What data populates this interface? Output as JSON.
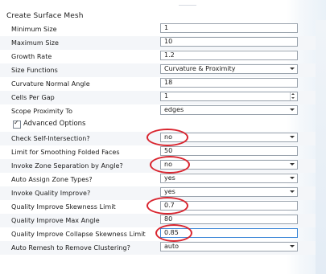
{
  "panel_title": "Create Surface Mesh",
  "basic_rows": [
    {
      "label": "Minimum Size",
      "value": "1",
      "control": "text"
    },
    {
      "label": "Maximum Size",
      "value": "10",
      "control": "text"
    },
    {
      "label": "Growth Rate",
      "value": "1.2",
      "control": "text"
    },
    {
      "label": "Size Functions",
      "value": "Curvature & Proximity",
      "control": "select"
    },
    {
      "label": "Curvature Normal Angle",
      "value": "18",
      "control": "text"
    },
    {
      "label": "Cells Per Gap",
      "value": "1",
      "control": "spin"
    },
    {
      "label": "Scope Proximity To",
      "value": "edges",
      "control": "select"
    }
  ],
  "advanced_options": {
    "label": "Advanced Options",
    "checked": true
  },
  "advanced_rows": [
    {
      "label": "Check Self-Intersection?",
      "value": "no",
      "control": "select"
    },
    {
      "label": "Limit for Smoothing Folded Faces",
      "value": "50",
      "control": "text"
    },
    {
      "label": "Invoke Zone Separation by Angle?",
      "value": "no",
      "control": "select"
    },
    {
      "label": "Auto Assign Zone Types?",
      "value": "yes",
      "control": "select"
    },
    {
      "label": "Invoke Quality Improve?",
      "value": "yes",
      "control": "select"
    },
    {
      "label": "Quality Improve Skewness Limit",
      "value": "0.7",
      "control": "text"
    },
    {
      "label": "Quality Improve Max Angle",
      "value": "80",
      "control": "text"
    },
    {
      "label": "Quality Improve Collapse Skewness Limit",
      "value": "0.85",
      "control": "text"
    },
    {
      "label": "Auto Remesh to Remove Clustering?",
      "value": "auto",
      "control": "select"
    }
  ],
  "colors": {
    "highlight_ellipse": "#d9252f",
    "focus_border": "#3b86d7"
  }
}
